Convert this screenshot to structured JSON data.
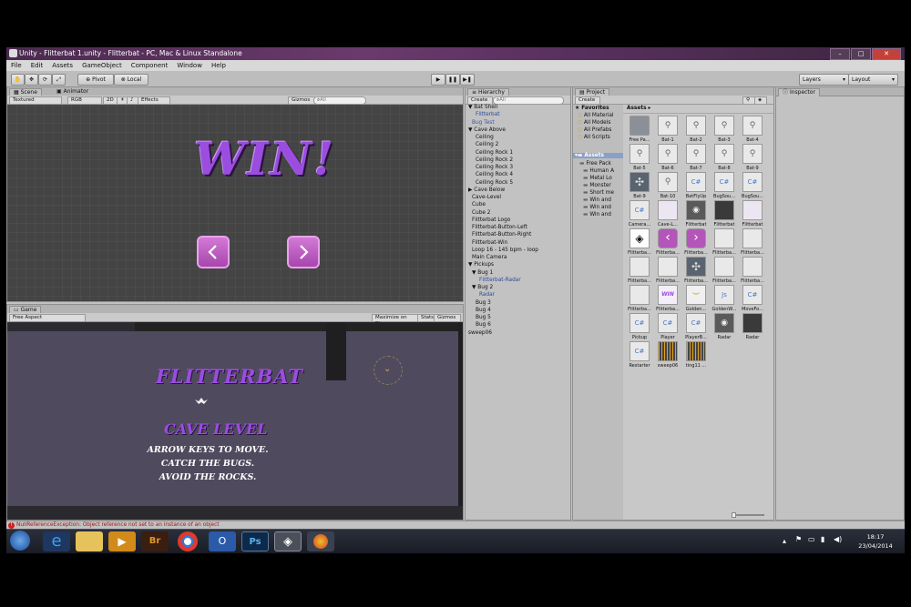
{
  "window": {
    "title": "Unity - Flitterbat 1.unity - Flitterbat - PC, Mac & Linux Standalone"
  },
  "menu": [
    "File",
    "Edit",
    "Assets",
    "GameObject",
    "Component",
    "Window",
    "Help"
  ],
  "toolbar": {
    "pivot": "Pivot",
    "local": "Local",
    "layers": "Layers",
    "layout": "Layout"
  },
  "scene": {
    "tabs": [
      "Scene",
      "Animator"
    ],
    "opts": {
      "shading": "Textured",
      "rgb": "RGB",
      "mode2d": "2D",
      "effects": "Effects",
      "gizmos": "Gizmos",
      "search": "All"
    },
    "win_text": "WIN!"
  },
  "game": {
    "tab": "Game",
    "aspect": "Free Aspect",
    "maximize": "Maximize on Play",
    "stats": "Stats",
    "gizmos": "Gizmos",
    "title": "FLITTERBAT",
    "level": "CAVE LEVEL",
    "instructions": [
      "ARROW KEYS TO MOVE.",
      "CATCH THE BUGS.",
      "AVOID THE ROCKS."
    ]
  },
  "hierarchy": {
    "tab": "Hierarchy",
    "create": "Create",
    "search": "All",
    "items": [
      {
        "label": "▼ Bat Shell",
        "indent": 0,
        "color": "#111"
      },
      {
        "label": "Flitterbat",
        "indent": 2,
        "color": "#2a4a9a"
      },
      {
        "label": "Bug Test",
        "indent": 1,
        "color": "#3a5aa8"
      },
      {
        "label": "▼ Cave Above",
        "indent": 0,
        "color": "#111"
      },
      {
        "label": "Ceiling",
        "indent": 2,
        "color": "#111"
      },
      {
        "label": "Ceiling 2",
        "indent": 2,
        "color": "#111"
      },
      {
        "label": "Ceiling Rock 1",
        "indent": 2,
        "color": "#111"
      },
      {
        "label": "Ceiling Rock 2",
        "indent": 2,
        "color": "#111"
      },
      {
        "label": "Ceiling Rock 3",
        "indent": 2,
        "color": "#111"
      },
      {
        "label": "Ceiling Rock 4",
        "indent": 2,
        "color": "#111"
      },
      {
        "label": "Ceiling Rock 5",
        "indent": 2,
        "color": "#111"
      },
      {
        "label": "▶ Cave Below",
        "indent": 0,
        "color": "#111"
      },
      {
        "label": "Cave-Level",
        "indent": 1,
        "color": "#111"
      },
      {
        "label": "Cube",
        "indent": 1,
        "color": "#111"
      },
      {
        "label": "Cube 2",
        "indent": 1,
        "color": "#111"
      },
      {
        "label": "Flitterbat Logo",
        "indent": 1,
        "color": "#111"
      },
      {
        "label": "Flitterbat-Button-Left",
        "indent": 1,
        "color": "#111"
      },
      {
        "label": "Flitterbat-Button-Right",
        "indent": 1,
        "color": "#111"
      },
      {
        "label": "Flitterbat-Win",
        "indent": 1,
        "color": "#111"
      },
      {
        "label": "Loop 16 - 145 bpm - loop",
        "indent": 1,
        "color": "#111"
      },
      {
        "label": "Main Camera",
        "indent": 1,
        "color": "#111"
      },
      {
        "label": "▼ Pickups",
        "indent": 0,
        "color": "#111"
      },
      {
        "label": "▼ Bug 1",
        "indent": 1,
        "color": "#111"
      },
      {
        "label": "Flitterbat-Radar",
        "indent": 3,
        "color": "#2a4a9a"
      },
      {
        "label": "▼ Bug 2",
        "indent": 1,
        "color": "#111"
      },
      {
        "label": "Radar",
        "indent": 3,
        "color": "#2a4a9a"
      },
      {
        "label": "Bug 3",
        "indent": 2,
        "color": "#111"
      },
      {
        "label": "Bug 4",
        "indent": 2,
        "color": "#111"
      },
      {
        "label": "Bug 5",
        "indent": 2,
        "color": "#111"
      },
      {
        "label": "Bug 6",
        "indent": 2,
        "color": "#111"
      },
      {
        "label": "sweep06",
        "indent": 0,
        "color": "#111"
      }
    ]
  },
  "project": {
    "tab": "Project",
    "create": "Create",
    "favorites_label": "Favorites",
    "favorites": [
      "All Material",
      "All Models",
      "All Prefabs",
      "All Scripts"
    ],
    "assets_label": "Assets",
    "folders": [
      {
        "label": "Free Pack",
        "indent": 0
      },
      {
        "label": "Human A",
        "indent": 1
      },
      {
        "label": "Metal Lo",
        "indent": 1
      },
      {
        "label": "Monster",
        "indent": 1
      },
      {
        "label": "Short me",
        "indent": 1
      },
      {
        "label": "Win and",
        "indent": 1
      },
      {
        "label": "Win and",
        "indent": 1
      },
      {
        "label": "Win and",
        "indent": 1
      }
    ],
    "breadcrumb": "Assets ▸",
    "assets": [
      {
        "label": "Free Pa...",
        "kind": "folder"
      },
      {
        "label": "Bat-1",
        "kind": "sprite"
      },
      {
        "label": "Bat-2",
        "kind": "sprite"
      },
      {
        "label": "Bat-3",
        "kind": "sprite"
      },
      {
        "label": "Bat-4",
        "kind": "sprite"
      },
      {
        "label": "Bat-5",
        "kind": "sprite"
      },
      {
        "label": "Bat-6",
        "kind": "sprite"
      },
      {
        "label": "Bat-7",
        "kind": "sprite"
      },
      {
        "label": "Bat-8",
        "kind": "sprite"
      },
      {
        "label": "Bat-9",
        "kind": "sprite"
      },
      {
        "label": "Bat-9",
        "kind": "grid"
      },
      {
        "label": "Bat-10",
        "kind": "sprite"
      },
      {
        "label": "BatFlyUp",
        "kind": "script"
      },
      {
        "label": "BugSou...",
        "kind": "script"
      },
      {
        "label": "BugSou...",
        "kind": "script"
      },
      {
        "label": "Camera...",
        "kind": "script"
      },
      {
        "label": "Cave-L...",
        "kind": "image"
      },
      {
        "label": "Flitterbat",
        "kind": "audio"
      },
      {
        "label": "Flitterbat",
        "kind": "dark"
      },
      {
        "label": "Flitterbat",
        "kind": "image"
      },
      {
        "label": "Flitterba...",
        "kind": "unity"
      },
      {
        "label": "Flitterba...",
        "kind": "left"
      },
      {
        "label": "Flitterba...",
        "kind": "right"
      },
      {
        "label": "Flitterba...",
        "kind": "blank"
      },
      {
        "label": "Flitterba...",
        "kind": "blank"
      },
      {
        "label": "Flitterba...",
        "kind": "blank"
      },
      {
        "label": "Flitterba...",
        "kind": "blank"
      },
      {
        "label": "Flitterba...",
        "kind": "grid"
      },
      {
        "label": "Flitterba...",
        "kind": "blank"
      },
      {
        "label": "Flitterba...",
        "kind": "blank"
      },
      {
        "label": "Flitterba...",
        "kind": "blank"
      },
      {
        "label": "Flitterba...",
        "kind": "win"
      },
      {
        "label": "Golden...",
        "kind": "gold"
      },
      {
        "label": "GoldenW...",
        "kind": "js"
      },
      {
        "label": "MoveFo...",
        "kind": "script"
      },
      {
        "label": "Pickup",
        "kind": "script"
      },
      {
        "label": "Player",
        "kind": "script"
      },
      {
        "label": "PlayerB...",
        "kind": "script"
      },
      {
        "label": "Radar",
        "kind": "audio"
      },
      {
        "label": "Radar",
        "kind": "dark"
      },
      {
        "label": "Restarter",
        "kind": "script"
      },
      {
        "label": "sweep06",
        "kind": "wave"
      },
      {
        "label": "ting11 ...",
        "kind": "wave"
      }
    ]
  },
  "inspector": {
    "tab": "Inspector"
  },
  "status": {
    "error": "NullReferenceException: Object reference not set to an instance of an object"
  },
  "taskbar": {
    "time": "18:17",
    "date": "23/04/2014"
  },
  "colors": {
    "accent": "#a746ad",
    "title_purple": "#9b4de0",
    "error": "#d02020"
  }
}
